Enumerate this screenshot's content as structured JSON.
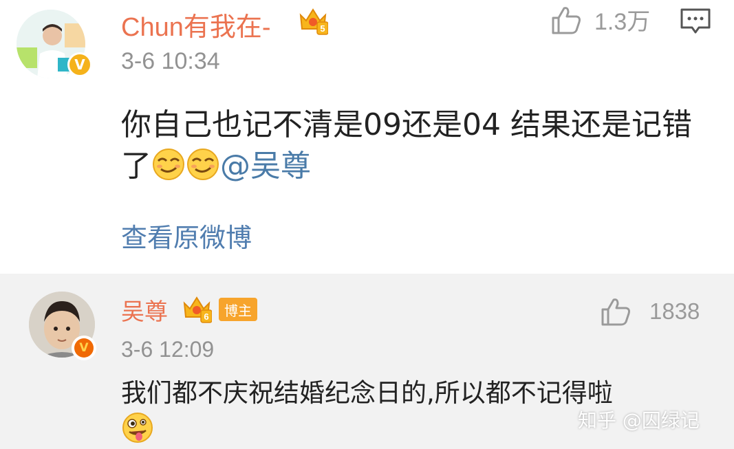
{
  "comment1": {
    "username": "Chun有我在-",
    "level": "5",
    "time": "3-6 10:34",
    "likes": "1.3万",
    "text_before": "你自己也记不清是09还是04 结果还是记错了",
    "mention": "@吴尊",
    "view_original": "查看原微博"
  },
  "comment2": {
    "username": "吴尊",
    "level": "6",
    "badge": "博主",
    "time": "3-6 12:09",
    "likes": "1838",
    "text": "我们都不庆祝结婚纪念日的,所以都不记得啦"
  },
  "watermark": "知乎 @囚绿记",
  "colors": {
    "username": "#eb7350",
    "link": "#507daf",
    "meta": "#929292",
    "badge": "#f7a42c"
  },
  "icons": [
    "like-icon",
    "comment-reply-icon",
    "crown-level-icon",
    "verified-v-icon",
    "smirk-emoji",
    "crazy-face-emoji"
  ]
}
